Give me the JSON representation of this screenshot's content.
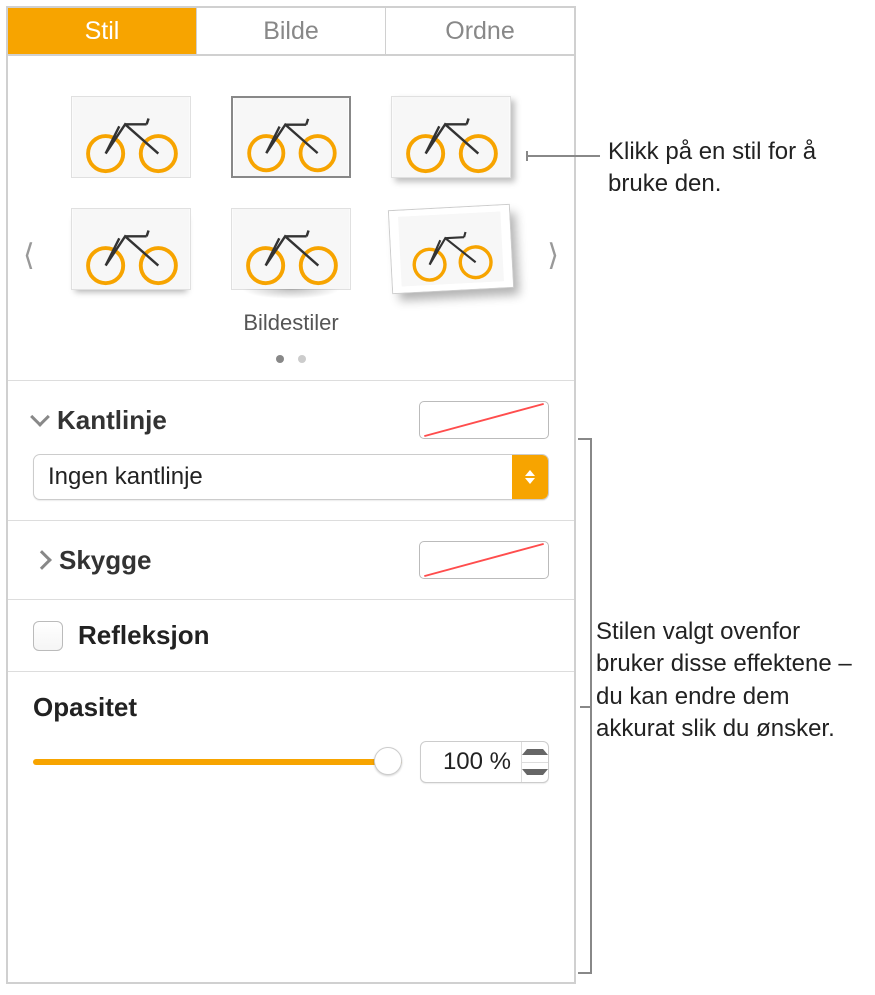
{
  "tabs": {
    "stil": "Stil",
    "bilde": "Bilde",
    "ordne": "Ordne"
  },
  "styles": {
    "label": "Bildestiler"
  },
  "border": {
    "label": "Kantlinje",
    "select_value": "Ingen kantlinje"
  },
  "shadow": {
    "label": "Skygge"
  },
  "reflection": {
    "label": "Refleksjon"
  },
  "opacity": {
    "label": "Opasitet",
    "value": "100 %"
  },
  "callouts": {
    "c1": "Klikk på en stil for å bruke den.",
    "c2": "Stilen valgt ovenfor bruker disse effektene – du kan endre dem akkurat slik du ønsker."
  }
}
